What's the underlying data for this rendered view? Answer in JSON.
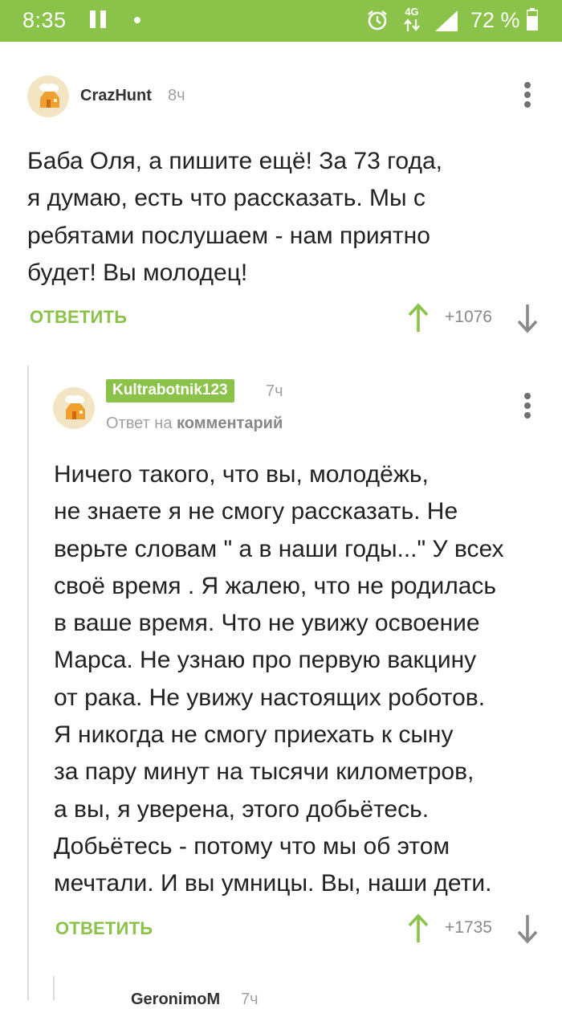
{
  "status_bar": {
    "time": "8:35",
    "network": "4G",
    "battery": "72 %"
  },
  "comments": [
    {
      "username": "CrazHunt",
      "time": "8ч",
      "text_lines": [
        "Баба Оля, а пишите ещё! За 73 года,",
        "я думаю, есть что рассказать. Мы с",
        "ребятами послушаем - нам приятно",
        "будет! Вы молодец!"
      ],
      "reply_label": "ОТВЕТИТЬ",
      "rating": "+1076"
    },
    {
      "username": "Kultrabotnik123",
      "time": "7ч",
      "reply_to_prefix": "Ответ на",
      "reply_to_link": "комментарий",
      "text_lines": [
        "Ничего такого, что вы, молодёжь,",
        "не знаете я не смогу рассказать. Не",
        "верьте словам \" а в наши годы...\" У всех",
        "своё время . Я жалею, что не родилась",
        "в ваше время. Что не увижу освоение",
        "Марса. Не узнаю про первую вакцину",
        "от рака. Не увижу настоящих роботов.",
        "Я никогда не смогу приехать к сыну",
        "за пару минут на тысячи километров,",
        "а вы, я уверена, этого добьётесь.",
        "Добьётесь - потому что мы об этом",
        "мечтали. И вы умницы. Вы, наши дети."
      ],
      "reply_label": "ОТВЕТИТЬ",
      "rating": "+1735"
    },
    {
      "username": "GeronimoM",
      "time": "7ч"
    }
  ],
  "colors": {
    "accent": "#8ac24a",
    "text": "#222222",
    "muted": "#a0a0a0"
  }
}
